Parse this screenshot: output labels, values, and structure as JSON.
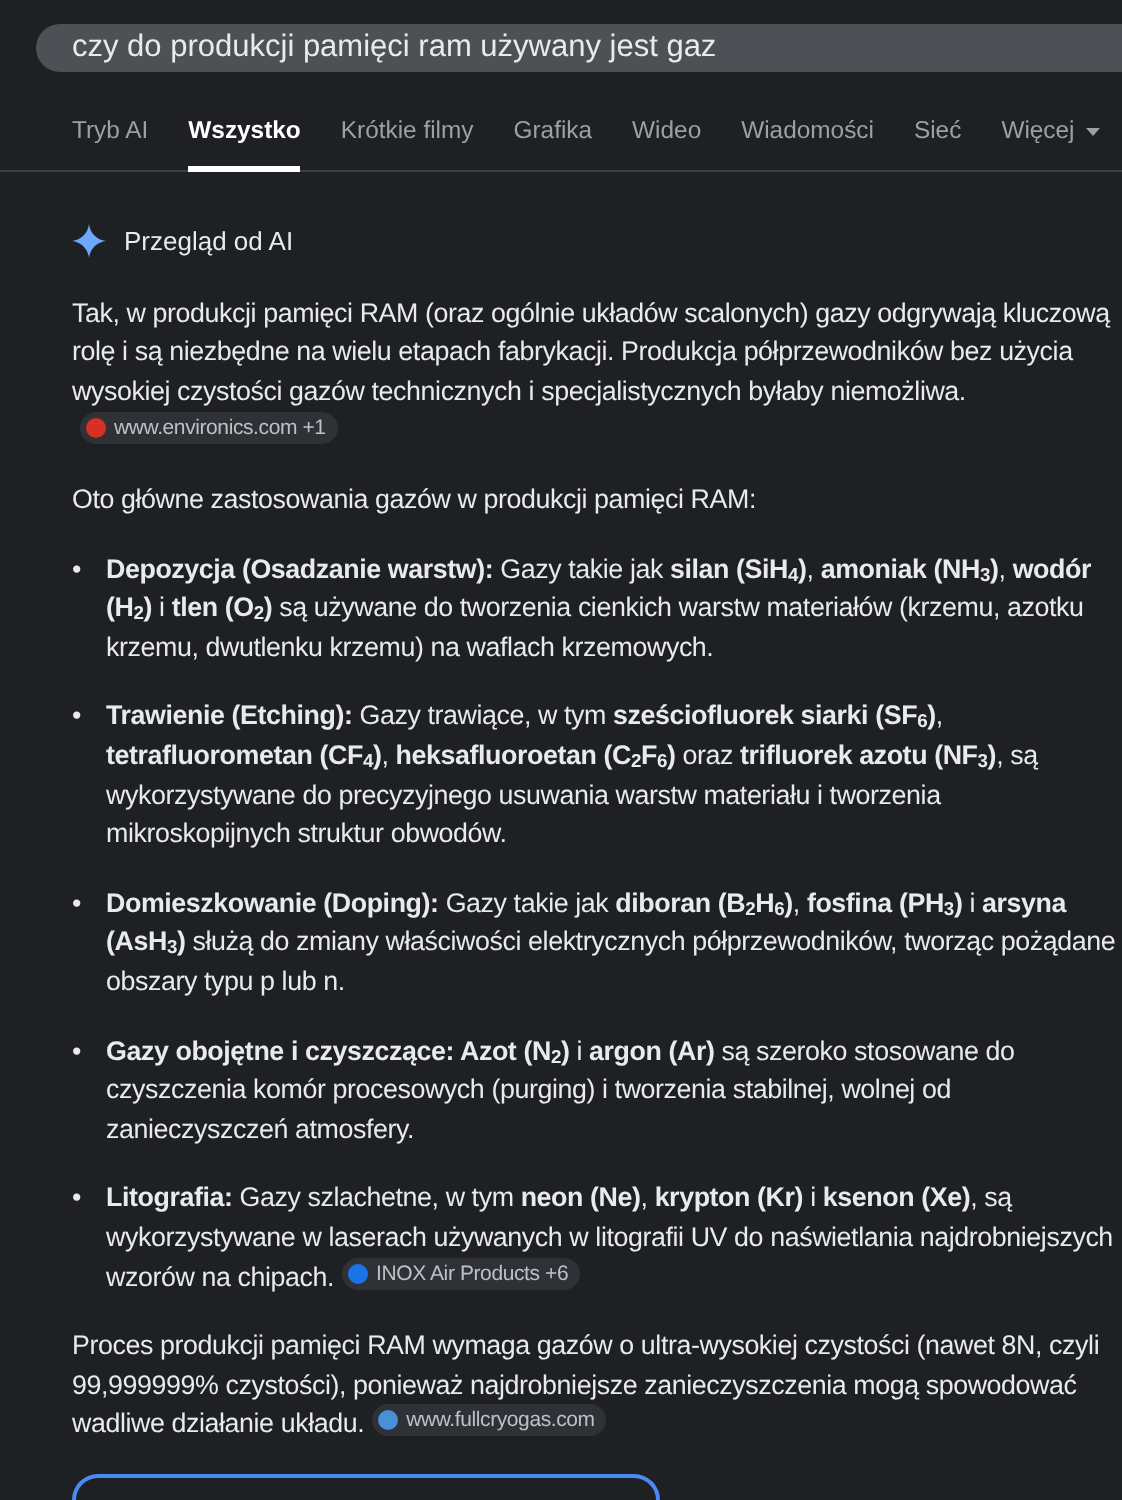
{
  "search": {
    "value": "czy do produkcji pamięci ram używany jest gaz"
  },
  "tabs": [
    {
      "label": "Tryb AI",
      "selected": false,
      "dropdown": false
    },
    {
      "label": "Wszystko",
      "selected": true,
      "dropdown": false
    },
    {
      "label": "Krótkie filmy",
      "selected": false,
      "dropdown": false
    },
    {
      "label": "Grafika",
      "selected": false,
      "dropdown": false
    },
    {
      "label": "Wideo",
      "selected": false,
      "dropdown": false
    },
    {
      "label": "Wiadomości",
      "selected": false,
      "dropdown": false
    },
    {
      "label": "Sieć",
      "selected": false,
      "dropdown": false
    },
    {
      "label": "Więcej",
      "selected": false,
      "dropdown": true
    }
  ],
  "ai_overview": {
    "title": "Przegląd od AI",
    "blocks": [
      {
        "kind": "paragraph",
        "text": "Tak, w produkcji pamięci RAM (oraz ogólnie układów scalonych) gazy odgrywają kluczową rolę i są niezbędne na wielu etapach fabrykacji. Produkcja półprzewodników bez użycia wysokiej czystości gazów technicznych i specjalistycznych byłaby niemożliwa.",
        "source": {
          "label": "www.environics.com +1",
          "color": "#d93025"
        }
      },
      {
        "kind": "paragraph",
        "text": "Oto główne zastosowania gazów w produkcji pamięci RAM:"
      },
      {
        "kind": "list",
        "marker": "•",
        "items": [
          {
            "text": "**Depozycja (Osadzanie warstw):** Gazy takie jak **silan (SiH$_{4}$)**, **amoniak (NH$_{3}$)**, **wodór (H$_{2}$)** i **tlen (O$_{2}$)** są używane do tworzenia cienkich warstw materiałów (krzemu, azotku krzemu, dwutlenku krzemu) na waflach krzemowych."
          },
          {
            "text": "**Trawienie (Etching):** Gazy trawiące, w tym **sześciofluorek siarki (SF$_{6}$)**, **tetrafluorometan (CF$_{4}$)**, **heksafluoroetan (C$_{2}$F$_{6}$)** oraz **trifluorek azotu (NF$_{3}$)**, są wykorzystywane do precyzyjnego usuwania warstw materiału i tworzenia mikroskopijnych struktur obwodów."
          },
          {
            "text": "**Domieszkowanie (Doping):** Gazy takie jak **diboran (B$_{2}$H$_{6}$)**, **fosfina (PH$_{3}$)** i **arsyna (AsH$_{3}$)** służą do zmiany właściwości elektrycznych półprzewodników, tworząc pożądane obszary typu p lub n."
          },
          {
            "text": "**Gazy obojętne i czyszczące: Azot (N$_{2}$)** i **argon (Ar)** są szeroko stosowane do czyszczenia komór procesowych (purging) i tworzenia stabilnej, wolnej od zanieczyszczeń atmosfery."
          },
          {
            "text": "**Litografia:** Gazy szlachetne, w tym **neon (Ne)**, **krypton (Kr)** i **ksenon (Xe)**, są wykorzystywane w laserach używanych w litografii UV do naświetlania najdrobniejszych wzorów na chipach.",
            "source": {
              "label": "INOX Air Products +6",
              "color": "#1a73e8"
            }
          }
        ]
      },
      {
        "kind": "paragraph",
        "text": "Proces produkcji pamięci RAM wymaga gazów o ultra-wysokiej czystości (nawet 8N, czyli 99,999999% czystości), ponieważ najdrobniejsze zanieczyszczenia mogą spowodować wadliwe działanie układu.",
        "source": {
          "label": "www.fullcryogas.com",
          "color": "#4a90d9"
        }
      }
    ]
  }
}
